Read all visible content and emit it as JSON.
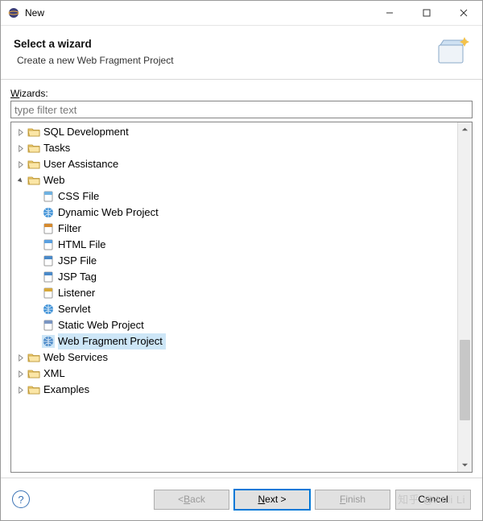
{
  "window": {
    "title": "New"
  },
  "banner": {
    "title": "Select a wizard",
    "description": "Create a new Web Fragment Project"
  },
  "wizards_label_prefix": "W",
  "wizards_label_rest": "izards:",
  "filter_placeholder": "type filter text",
  "tree": {
    "folders_top": [
      {
        "label": "SQL Development"
      },
      {
        "label": "Tasks"
      },
      {
        "label": "User Assistance"
      }
    ],
    "web": {
      "label": "Web",
      "children": [
        {
          "label": "CSS File",
          "icon": "css"
        },
        {
          "label": "Dynamic Web Project",
          "icon": "globe"
        },
        {
          "label": "Filter",
          "icon": "filter"
        },
        {
          "label": "HTML File",
          "icon": "html"
        },
        {
          "label": "JSP File",
          "icon": "jsp"
        },
        {
          "label": "JSP Tag",
          "icon": "jsp"
        },
        {
          "label": "Listener",
          "icon": "listener"
        },
        {
          "label": "Servlet",
          "icon": "servlet"
        },
        {
          "label": "Static Web Project",
          "icon": "static"
        },
        {
          "label": "Web Fragment Project",
          "icon": "fragment",
          "selected": true
        }
      ]
    },
    "folders_bottom": [
      {
        "label": "Web Services"
      },
      {
        "label": "XML"
      },
      {
        "label": "Examples"
      }
    ]
  },
  "buttons": {
    "back": {
      "prefix": "< ",
      "u": "B",
      "rest": "ack"
    },
    "next": {
      "u": "N",
      "rest": "ext >"
    },
    "finish": {
      "u": "F",
      "rest": "inish"
    },
    "cancel": {
      "label": "Cancel"
    }
  },
  "watermark": "知乎 @Anli Li"
}
